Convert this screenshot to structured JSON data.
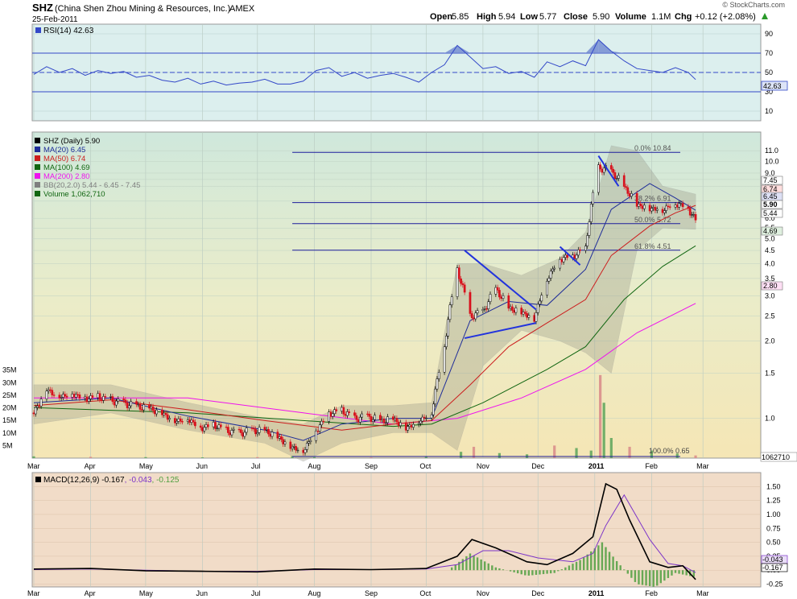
{
  "header": {
    "symbol": "SHZ",
    "company": "(China Shen Zhou Mining & Resources, Inc.)",
    "exchange": "AMEX",
    "date": "25-Feb-2011",
    "watermark": "© StockCharts.com",
    "quote": {
      "open_label": "Open",
      "open": "5.85",
      "high_label": "High",
      "high": "5.94",
      "low_label": "Low",
      "low": "5.77",
      "close_label": "Close",
      "close": "5.90",
      "volume_label": "Volume",
      "volume": "1.1M",
      "chg_label": "Chg",
      "chg": "+0.12 (+2.08%)"
    },
    "quote_arrow": "up-arrow-icon"
  },
  "colors": {
    "rsi_bg": "#dcefee",
    "rsi_line": "#3348c8",
    "rsi_fill": "#6f87cf",
    "price_bg_top": "#cfe8dc",
    "price_bg_bottom": "#f5e6b5",
    "macd_bg": "#f1dcc8",
    "up_candle": "#000000",
    "down_candle": "#d8101c",
    "ma20": "#1e2c98",
    "ma50": "#cc1d1d",
    "ma100": "#116611",
    "ma200": "#ee11ee",
    "bb": "#7f7f7f",
    "volume_up": "#5ba35b",
    "volume_down": "#d88888",
    "fib": "#1c1c9c",
    "trendline": "#2233dd",
    "macd": "#000000",
    "signal": "#7c33c8",
    "histogram": "#4f9f3f"
  },
  "chart_data": [
    {
      "type": "line",
      "title": "RSI(14) 42.63",
      "indicator": "RSI(14)",
      "last_value": 42.63,
      "ylim": [
        0,
        100
      ],
      "y_ticks": [
        10,
        30,
        50,
        70,
        90
      ],
      "reference_lines": [
        30,
        50,
        70
      ],
      "x_ticks": [
        "Mar",
        "Apr",
        "May",
        "Jun",
        "Jul",
        "Aug",
        "Sep",
        "Oct",
        "Nov",
        "Dec",
        "2011",
        "Feb",
        "Mar"
      ],
      "value_label": "42.63",
      "series": [
        {
          "name": "RSI(14)",
          "x": [
            "2010-03-01",
            "2010-03-08",
            "2010-03-15",
            "2010-03-22",
            "2010-03-29",
            "2010-04-05",
            "2010-04-12",
            "2010-04-19",
            "2010-04-26",
            "2010-05-03",
            "2010-05-10",
            "2010-05-17",
            "2010-05-24",
            "2010-05-31",
            "2010-06-07",
            "2010-06-14",
            "2010-06-21",
            "2010-06-28",
            "2010-07-05",
            "2010-07-12",
            "2010-07-19",
            "2010-07-26",
            "2010-08-02",
            "2010-08-09",
            "2010-08-16",
            "2010-08-23",
            "2010-08-30",
            "2010-09-06",
            "2010-09-13",
            "2010-09-20",
            "2010-09-27",
            "2010-10-04",
            "2010-10-11",
            "2010-10-18",
            "2010-10-25",
            "2010-11-01",
            "2010-11-08",
            "2010-11-15",
            "2010-11-22",
            "2010-11-29",
            "2010-12-06",
            "2010-12-13",
            "2010-12-20",
            "2010-12-27",
            "2011-01-03",
            "2011-01-10",
            "2011-01-17",
            "2011-01-24",
            "2011-01-31",
            "2011-02-07",
            "2011-02-14",
            "2011-02-21",
            "2011-02-25"
          ],
          "values": [
            48,
            56,
            50,
            54,
            47,
            52,
            49,
            51,
            45,
            47,
            42,
            40,
            44,
            38,
            41,
            37,
            39,
            40,
            43,
            38,
            38,
            41,
            52,
            55,
            46,
            50,
            44,
            47,
            49,
            45,
            40,
            50,
            58,
            78,
            66,
            54,
            56,
            49,
            51,
            45,
            61,
            56,
            62,
            57,
            84,
            72,
            62,
            54,
            52,
            50,
            55,
            50,
            42.63
          ]
        }
      ]
    },
    {
      "type": "candlestick",
      "title": "SHZ (Daily) 5.90",
      "scale": "log",
      "ylim": [
        0.7,
        13
      ],
      "y_ticks": [
        1.0,
        1.5,
        2.0,
        2.5,
        3.0,
        3.5,
        4.0,
        4.5,
        5.0,
        5.5,
        6.0,
        7.0,
        8.0,
        8.5,
        9.0,
        10.0,
        11.0
      ],
      "x_ticks": [
        "Mar",
        "Apr",
        "May",
        "Jun",
        "Jul",
        "Aug",
        "Sep",
        "Oct",
        "Nov",
        "Dec",
        "2011",
        "Feb",
        "Mar"
      ],
      "legend": [
        {
          "label": "SHZ (Daily) 5.90",
          "color": "#000000"
        },
        {
          "label": "MA(20) 6.45",
          "color": "#1e2c98"
        },
        {
          "label": "MA(50) 6.74",
          "color": "#cc1d1d"
        },
        {
          "label": "MA(100) 4.69",
          "color": "#116611"
        },
        {
          "label": "MA(200) 2.80",
          "color": "#ee11ee"
        },
        {
          "label": "BB(20,2.0) 5.44 - 6.45 - 7.45",
          "color": "#7f7f7f"
        },
        {
          "label": "Volume 1,062,710",
          "color": "#116611"
        }
      ],
      "right_labels": [
        "7.45",
        "6.74",
        "6.45",
        "5.90",
        "5.44",
        "4.69",
        "2.80"
      ],
      "fibonacci": [
        {
          "label": "0.0% 10.84",
          "value": 10.84
        },
        {
          "label": "38.2% 6.91",
          "value": 6.91
        },
        {
          "label": "50.0% 5.72",
          "value": 5.72
        },
        {
          "label": "61.8% 4.51",
          "value": 4.51
        }
      ],
      "annotation": "100.0% 0.65",
      "price_series": {
        "x": [
          "2010-03-01",
          "2010-03-08",
          "2010-03-15",
          "2010-03-22",
          "2010-03-29",
          "2010-04-05",
          "2010-04-12",
          "2010-04-19",
          "2010-04-26",
          "2010-05-03",
          "2010-05-10",
          "2010-05-17",
          "2010-05-24",
          "2010-05-31",
          "2010-06-07",
          "2010-06-14",
          "2010-06-21",
          "2010-06-28",
          "2010-07-05",
          "2010-07-12",
          "2010-07-19",
          "2010-07-26",
          "2010-08-02",
          "2010-08-09",
          "2010-08-16",
          "2010-08-23",
          "2010-08-30",
          "2010-09-06",
          "2010-09-13",
          "2010-09-20",
          "2010-09-27",
          "2010-10-04",
          "2010-10-11",
          "2010-10-18",
          "2010-10-25",
          "2010-11-01",
          "2010-11-08",
          "2010-11-15",
          "2010-11-22",
          "2010-11-29",
          "2010-12-06",
          "2010-12-13",
          "2010-12-20",
          "2010-12-27",
          "2011-01-03",
          "2011-01-10",
          "2011-01-17",
          "2011-01-24",
          "2011-01-31",
          "2011-02-07",
          "2011-02-14",
          "2011-02-21",
          "2011-02-25"
        ],
        "close": [
          1.05,
          1.3,
          1.22,
          1.25,
          1.2,
          1.22,
          1.18,
          1.15,
          1.12,
          1.1,
          1.05,
          0.98,
          1.0,
          0.92,
          0.95,
          0.9,
          0.88,
          0.9,
          0.9,
          0.85,
          0.78,
          0.75,
          0.9,
          1.05,
          1.08,
          1.0,
          1.02,
          0.98,
          1.0,
          0.92,
          0.98,
          1.05,
          1.9,
          3.8,
          2.5,
          2.6,
          3.2,
          2.7,
          2.6,
          2.45,
          3.5,
          4.2,
          4.3,
          4.6,
          9.5,
          9.2,
          8.0,
          6.8,
          6.6,
          6.5,
          6.9,
          6.6,
          5.9
        ]
      },
      "ma20": {
        "x": [
          "2010-03-01",
          "2010-04-12",
          "2010-05-24",
          "2010-07-05",
          "2010-07-26",
          "2010-08-16",
          "2010-09-13",
          "2010-10-04",
          "2010-10-25",
          "2010-11-15",
          "2010-12-06",
          "2010-12-27",
          "2011-01-10",
          "2011-01-31",
          "2011-02-14",
          "2011-02-25"
        ],
        "values": [
          1.15,
          1.2,
          1.02,
          0.9,
          0.82,
          0.95,
          1.0,
          1.0,
          2.4,
          2.85,
          2.75,
          3.8,
          6.5,
          8.2,
          7.2,
          6.45
        ]
      },
      "ma50": {
        "x": [
          "2010-03-01",
          "2010-04-12",
          "2010-05-24",
          "2010-07-05",
          "2010-08-16",
          "2010-09-13",
          "2010-10-04",
          "2010-10-25",
          "2010-11-15",
          "2010-12-06",
          "2010-12-27",
          "2011-01-10",
          "2011-01-31",
          "2011-02-14",
          "2011-02-25"
        ],
        "values": [
          1.12,
          1.18,
          1.08,
          0.98,
          0.9,
          0.95,
          0.98,
          1.35,
          1.9,
          2.35,
          2.9,
          4.3,
          5.6,
          6.3,
          6.74
        ]
      },
      "ma100": {
        "x": [
          "2010-03-01",
          "2010-05-24",
          "2010-07-26",
          "2010-09-13",
          "2010-10-04",
          "2010-11-01",
          "2010-12-06",
          "2010-12-27",
          "2011-01-17",
          "2011-02-07",
          "2011-02-25"
        ],
        "values": [
          1.1,
          1.05,
          0.98,
          0.93,
          0.95,
          1.15,
          1.55,
          1.9,
          2.9,
          3.9,
          4.69
        ]
      },
      "ma200": {
        "x": [
          "2010-03-01",
          "2010-05-24",
          "2010-07-26",
          "2010-09-13",
          "2010-10-18",
          "2010-11-22",
          "2010-12-27",
          "2011-01-24",
          "2011-02-25"
        ],
        "values": [
          1.2,
          1.2,
          1.05,
          0.95,
          1.0,
          1.2,
          1.55,
          2.15,
          2.8
        ]
      },
      "bollinger": {
        "x": [
          "2010-03-01",
          "2010-04-12",
          "2010-05-24",
          "2010-07-05",
          "2010-07-26",
          "2010-08-16",
          "2010-09-13",
          "2010-10-04",
          "2010-10-18",
          "2010-11-01",
          "2010-11-22",
          "2010-12-13",
          "2010-12-27",
          "2011-01-10",
          "2011-01-24",
          "2011-02-07",
          "2011-02-25"
        ],
        "upper": [
          1.35,
          1.35,
          1.15,
          1.0,
          0.95,
          1.12,
          1.12,
          1.15,
          4.0,
          4.0,
          3.6,
          4.2,
          5.3,
          11.5,
          11.0,
          8.0,
          7.45
        ],
        "lower": [
          0.95,
          1.05,
          0.9,
          0.8,
          0.68,
          0.8,
          0.88,
          0.88,
          0.75,
          1.6,
          2.2,
          2.0,
          1.8,
          1.5,
          4.5,
          5.5,
          5.44
        ]
      },
      "trendlines": [
        {
          "from": [
            "2010-10-22",
            4.5
          ],
          "to": [
            "2010-11-30",
            2.65
          ]
        },
        {
          "from": [
            "2010-10-22",
            2.05
          ],
          "to": [
            "2010-11-30",
            2.35
          ]
        },
        {
          "from": [
            "2010-12-13",
            4.65
          ],
          "to": [
            "2010-12-24",
            3.95
          ]
        },
        {
          "from": [
            "2011-01-03",
            10.5
          ],
          "to": [
            "2011-01-14",
            8.0
          ]
        }
      ]
    },
    {
      "type": "bar",
      "title": "Volume 1,062,710",
      "ylim": [
        0,
        40000000
      ],
      "y_ticks": [
        "5M",
        "10M",
        "15M",
        "20M",
        "25M",
        "30M",
        "35M"
      ],
      "value_label": "1062710",
      "x": [
        "2010-03-01",
        "2010-04-01",
        "2010-05-01",
        "2010-06-01",
        "2010-07-01",
        "2010-07-20",
        "2010-08-01",
        "2010-09-01",
        "2010-10-01",
        "2010-10-20",
        "2010-10-27",
        "2010-11-10",
        "2010-11-25",
        "2010-12-10",
        "2010-12-22",
        "2010-12-30",
        "2011-01-04",
        "2011-01-06",
        "2011-01-10",
        "2011-01-20",
        "2011-02-01",
        "2011-02-15",
        "2011-02-25"
      ],
      "values": [
        700000,
        500000,
        400000,
        300000,
        400000,
        800000,
        400000,
        300000,
        500000,
        2500000,
        4500000,
        2000000,
        1500000,
        5000000,
        4000000,
        3000000,
        33000000,
        22000000,
        8000000,
        4500000,
        3000000,
        1800000,
        1062710
      ]
    },
    {
      "type": "line",
      "title": "MACD(12,26,9) -0.167, -0.043, -0.125",
      "indicator": "MACD(12,26,9)",
      "legend": [
        {
          "label": "MACD(12,26,9) -0.167",
          "color": "#000000"
        },
        {
          "label": ", -0.043",
          "color": "#7c33c8"
        },
        {
          "label": ", -0.125",
          "color": "#4f9f3f"
        }
      ],
      "ylim": [
        -0.3,
        1.75
      ],
      "y_ticks": [
        -0.25,
        0.0,
        0.25,
        0.5,
        0.75,
        1.0,
        1.25,
        1.5
      ],
      "value_labels": [
        "-0.043",
        "-0.167"
      ],
      "x_ticks": [
        "Mar",
        "Apr",
        "May",
        "Jun",
        "Jul",
        "Aug",
        "Sep",
        "Oct",
        "Nov",
        "Dec",
        "2011",
        "Feb",
        "Mar"
      ],
      "series": [
        {
          "name": "MACD",
          "x": [
            "2010-03-01",
            "2010-04-01",
            "2010-05-01",
            "2010-06-01",
            "2010-07-01",
            "2010-08-01",
            "2010-09-01",
            "2010-10-01",
            "2010-10-18",
            "2010-10-26",
            "2010-11-08",
            "2010-11-25",
            "2010-12-06",
            "2010-12-20",
            "2010-12-31",
            "2011-01-07",
            "2011-01-13",
            "2011-01-20",
            "2011-01-31",
            "2011-02-10",
            "2011-02-18",
            "2011-02-25"
          ],
          "values": [
            0.02,
            0.03,
            -0.01,
            -0.02,
            -0.03,
            0.02,
            0.01,
            0.03,
            0.25,
            0.55,
            0.4,
            0.15,
            0.1,
            0.3,
            0.6,
            1.55,
            1.45,
            0.9,
            0.15,
            0.05,
            0.08,
            -0.167
          ]
        },
        {
          "name": "Signal",
          "x": [
            "2010-03-01",
            "2010-04-01",
            "2010-05-01",
            "2010-06-01",
            "2010-07-01",
            "2010-08-01",
            "2010-09-01",
            "2010-10-01",
            "2010-10-18",
            "2010-11-01",
            "2010-11-15",
            "2010-12-01",
            "2010-12-20",
            "2010-12-31",
            "2011-01-07",
            "2011-01-17",
            "2011-01-31",
            "2011-02-10",
            "2011-02-18",
            "2011-02-25"
          ],
          "values": [
            0.01,
            0.02,
            0.0,
            -0.02,
            -0.02,
            0.01,
            0.01,
            0.02,
            0.1,
            0.35,
            0.35,
            0.22,
            0.15,
            0.3,
            0.8,
            1.35,
            0.55,
            0.12,
            0.08,
            -0.043
          ]
        },
        {
          "name": "Histogram",
          "x": [
            "2010-10-15",
            "2010-10-25",
            "2010-11-08",
            "2010-11-25",
            "2010-12-10",
            "2010-12-25",
            "2011-01-05",
            "2011-01-12",
            "2011-01-24",
            "2011-02-03",
            "2011-02-14",
            "2011-02-25"
          ],
          "values": [
            0.05,
            0.3,
            0.05,
            -0.1,
            -0.05,
            0.2,
            0.5,
            0.2,
            -0.25,
            -0.3,
            -0.05,
            -0.125
          ]
        }
      ]
    }
  ]
}
